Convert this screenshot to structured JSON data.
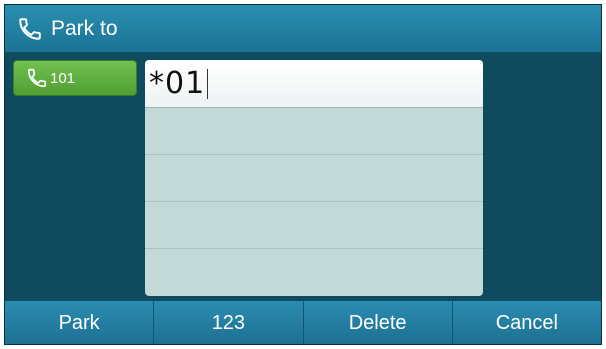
{
  "titlebar": {
    "title": "Park to",
    "icon": "phone-handset-icon"
  },
  "line_key": {
    "label": "101",
    "icon": "phone-handset-icon",
    "color": "#5fb03f"
  },
  "input": {
    "value": "*01"
  },
  "panel_rows": [
    "",
    "",
    "",
    ""
  ],
  "softkeys": [
    {
      "label": "Park"
    },
    {
      "label": "123"
    },
    {
      "label": "Delete"
    },
    {
      "label": "Cancel"
    }
  ],
  "colors": {
    "screen_bg": "#0f4a5e",
    "titlebar": "#1f7fa3",
    "panel": "#c3d9d8",
    "softkey_bar": "#2386aa"
  }
}
